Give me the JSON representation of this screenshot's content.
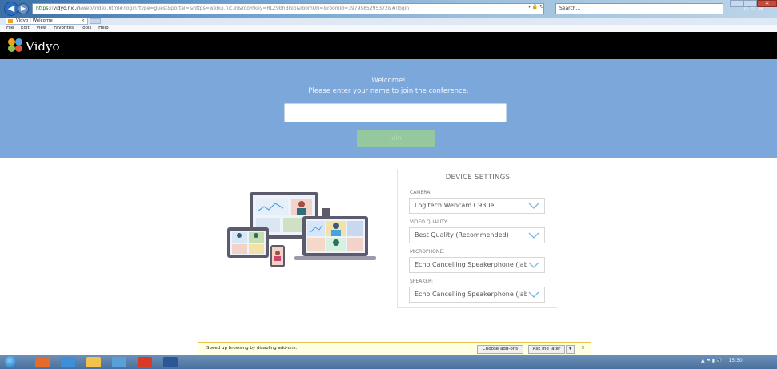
{
  "browser": {
    "address_scheme": "https",
    "address_host": "vidyo.nic.in",
    "address_rest": "/web/index.html#/login?type=guest&portal=&https=webui.nic.in&roomkey=RLZ9bhBGlb&roomUri=&roomId=3979585295372&#/login",
    "search_placeholder": "Search...",
    "tab_title": "Vidyo | Welcome",
    "menu": [
      "File",
      "Edit",
      "View",
      "Favorites",
      "Tools",
      "Help"
    ]
  },
  "header": {
    "brand": "Vidyo"
  },
  "banner": {
    "welcome": "Welcome!",
    "instruction": "Please enter your name to join the conference.",
    "name_value": "",
    "join_label": "Join"
  },
  "device_settings": {
    "title": "DEVICE SETTINGS",
    "camera_label": "CAMERA:",
    "camera_value": "Logitech Webcam C930e",
    "quality_label": "VIDEO QUALITY:",
    "quality_value": "Best Quality (Recommended)",
    "microphone_label": "MICROPHONE:",
    "microphone_value": "Echo Cancelling Speakerphone (Jabra",
    "speaker_label": "SPEAKER:",
    "speaker_value": "Echo Cancelling Speakerphone (Jabra"
  },
  "notification": {
    "text": "Speed up browsing by disabling add-ons.",
    "choose_label": "Choose add-ons",
    "later_label": "Ask me later"
  },
  "taskbar": {
    "clock": "15:30"
  },
  "colors": {
    "banner": "#7ba7db",
    "header": "#000000",
    "join_button": "#96c8a0"
  }
}
